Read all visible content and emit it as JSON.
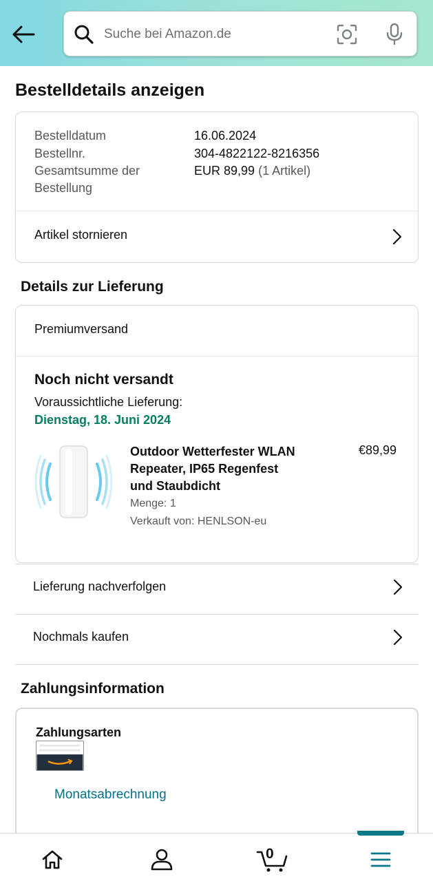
{
  "header": {
    "search_placeholder": "Suche bei Amazon.de",
    "icons": [
      "back-arrow-icon",
      "search-icon",
      "camera-icon",
      "microphone-icon"
    ]
  },
  "page_title": "Bestelldetails anzeigen",
  "order": {
    "date_label": "Bestelldatum",
    "date_value": "16.06.2024",
    "number_label": "Bestellnr.",
    "number_value": "304-4822122-8216356",
    "total_label_line1": "Gesamtsumme der",
    "total_label_line2": "Bestellung",
    "total_value": "EUR 89,99",
    "total_count": "(1 Artikel)",
    "cancel_label": "Artikel stornieren"
  },
  "delivery": {
    "section_title": "Details zur Lieferung",
    "shipping_type": "Premiumversand",
    "status": "Noch nicht versandt",
    "eta_label": "Voraussichtliche Lieferung:",
    "eta_date": "Dienstag, 18. Juni 2024",
    "eta_color": "#067d62",
    "product": {
      "name_line1": "Outdoor Wetterfester WLAN",
      "name_line2": "Repeater, IP65 Regenfest",
      "name_line3": "und Staubdicht",
      "price": "€89,99",
      "quantity": "Menge: 1",
      "seller": "Verkauft von: HENLSON-eu"
    }
  },
  "actions": {
    "track": "Lieferung nachverfolgen",
    "buy_again": "Nochmals kaufen"
  },
  "payment": {
    "section_title": "Zahlungsinformation",
    "methods_title": "Zahlungsarten",
    "method_link": "Monatsabrechnung",
    "link_color": "#007185"
  },
  "bottom_nav": {
    "cart_count": "0",
    "active_color": "#0a7a88",
    "icons": [
      "home-icon",
      "account-icon",
      "cart-icon",
      "menu-icon"
    ]
  }
}
